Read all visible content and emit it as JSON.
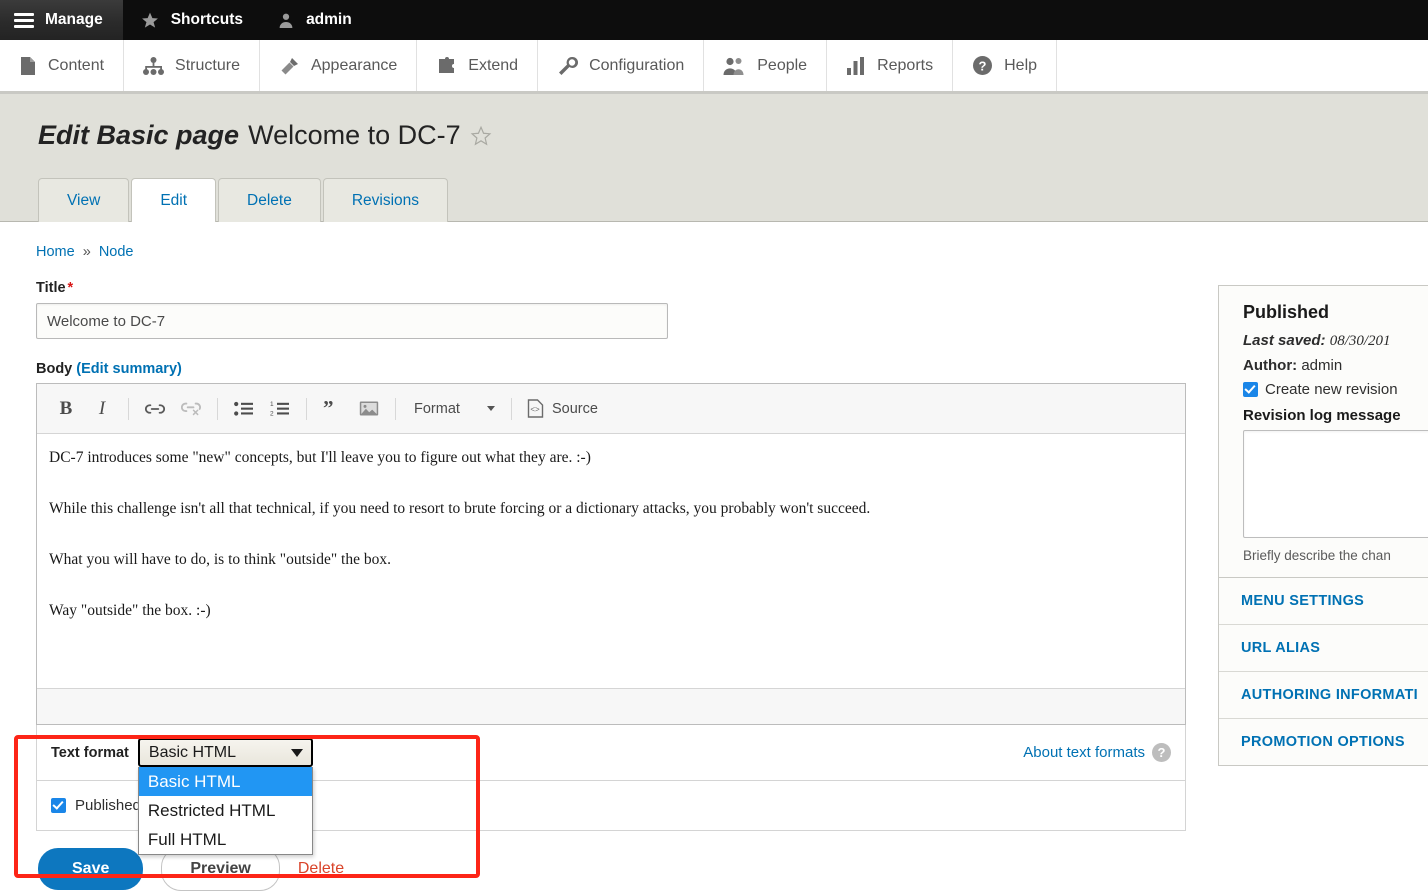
{
  "adminbar": {
    "manage": "Manage",
    "shortcuts": "Shortcuts",
    "account": "admin"
  },
  "mainmenu": {
    "items": [
      {
        "label": "Content",
        "icon": "document-icon"
      },
      {
        "label": "Structure",
        "icon": "sitemap-icon"
      },
      {
        "label": "Appearance",
        "icon": "paintbrush-icon"
      },
      {
        "label": "Extend",
        "icon": "puzzle-icon"
      },
      {
        "label": "Configuration",
        "icon": "wrench-icon"
      },
      {
        "label": "People",
        "icon": "people-icon"
      },
      {
        "label": "Reports",
        "icon": "bar-chart-icon"
      },
      {
        "label": "Help",
        "icon": "question-circle-icon"
      }
    ]
  },
  "page": {
    "title_prefix": "Edit Basic page",
    "title_name": "Welcome to DC-7",
    "star_icon": "star-outline-icon"
  },
  "tabs": [
    {
      "label": "View",
      "active": false
    },
    {
      "label": "Edit",
      "active": true
    },
    {
      "label": "Delete",
      "active": false
    },
    {
      "label": "Revisions",
      "active": false
    }
  ],
  "breadcrumb": {
    "home": "Home",
    "separator": "»",
    "node": "Node"
  },
  "form": {
    "title_label": "Title",
    "title_required": "*",
    "title_value": "Welcome to DC-7",
    "body_label": "Body",
    "body_summary_link": "(Edit summary)",
    "text_format_label": "Text format",
    "text_format_value": "Basic HTML",
    "text_format_options": [
      "Basic HTML",
      "Restricted HTML",
      "Full HTML"
    ],
    "about_text_formats": "About text formats",
    "help_icon": "question-mark-icon",
    "published_label": "Published"
  },
  "editor": {
    "toolbar": [
      {
        "name": "bold-icon",
        "glyph": "B"
      },
      {
        "name": "italic-icon",
        "glyph": "I"
      },
      {
        "name": "link-icon",
        "glyph": "link"
      },
      {
        "name": "unlink-icon",
        "glyph": "unlink"
      },
      {
        "name": "bulleted-list-icon",
        "glyph": "ul"
      },
      {
        "name": "numbered-list-icon",
        "glyph": "ol"
      },
      {
        "name": "blockquote-icon",
        "glyph": "quote"
      },
      {
        "name": "image-icon",
        "glyph": "image"
      }
    ],
    "format_label": "Format",
    "source_label": "Source",
    "body_paragraphs": [
      "DC-7 introduces some \"new\" concepts, but I'll leave you to figure out what they are.  :-)",
      "While this challenge isn't all that technical, if you need to resort to brute forcing or a dictionary attacks, you probably won't succeed.",
      "What you will have to do, is to think \"outside\" the box.",
      "Way \"outside\" the box.  :-)"
    ]
  },
  "actions": {
    "save": "Save",
    "preview": "Preview",
    "delete": "Delete"
  },
  "sidebar": {
    "status": "Published",
    "last_saved_label": "Last saved:",
    "last_saved_value": "08/30/201",
    "author_label": "Author:",
    "author_value": "admin",
    "create_new_revision": "Create new revision",
    "revision_log_label": "Revision log message",
    "revision_log_value": "",
    "revision_help": "Briefly describe the chan",
    "accordion": [
      "MENU SETTINGS",
      "URL ALIAS",
      "AUTHORING INFORMATI",
      "PROMOTION OPTIONS"
    ]
  },
  "colors": {
    "accent_blue": "#0071b3",
    "save_blue": "#0d77bf",
    "delete_red": "#d9442a",
    "highlight_red": "#fd2517",
    "select_highlight": "#2196f3"
  }
}
